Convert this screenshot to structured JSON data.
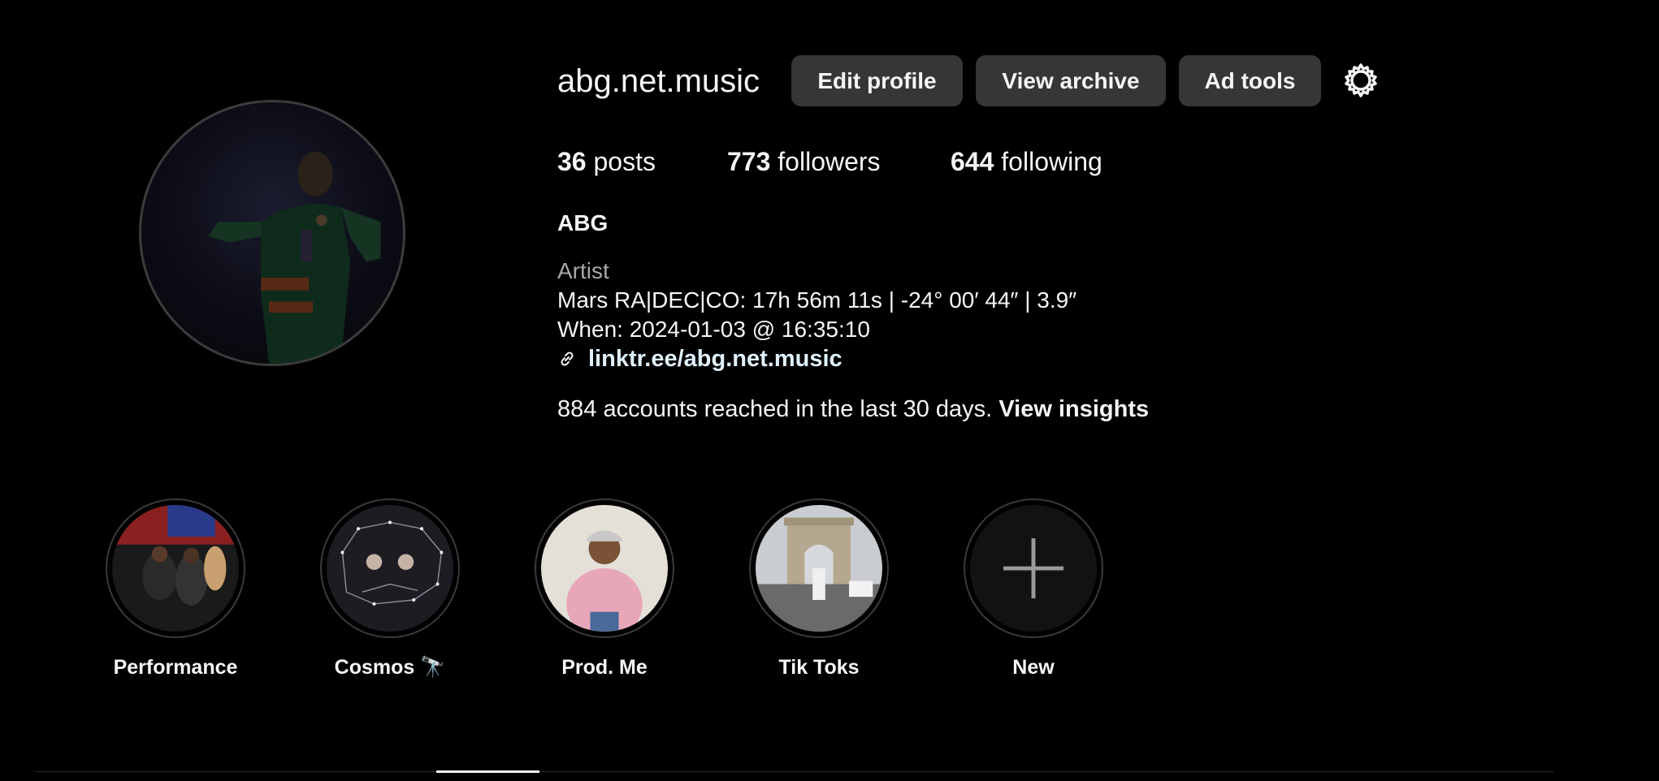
{
  "profile": {
    "username": "abg.net.music",
    "full_name": "ABG",
    "category": "Artist",
    "bio_lines": [
      "Mars RA|DEC|CO: 17h 56m 11s | -24° 00′ 44″ | 3.9″",
      "When: 2024-01-03 @ 16:35:10"
    ],
    "link": "linktr.ee/abg.net.music"
  },
  "actions": {
    "edit_profile": "Edit profile",
    "view_archive": "View archive",
    "ad_tools": "Ad tools"
  },
  "stats": {
    "posts_count": "36",
    "posts_label": "posts",
    "followers_count": "773",
    "followers_label": "followers",
    "following_count": "644",
    "following_label": "following"
  },
  "insights": {
    "text": "884 accounts reached in the last 30 days.",
    "link": "View insights"
  },
  "highlights": [
    {
      "label": "Performance"
    },
    {
      "label": "Cosmos 🔭"
    },
    {
      "label": "Prod. Me"
    },
    {
      "label": "Tik Toks"
    },
    {
      "label": "New"
    }
  ],
  "icons": {
    "settings": "gear-icon",
    "link": "link-icon",
    "new_highlight": "plus-icon"
  },
  "colors": {
    "background": "#000000",
    "button_bg": "#363636",
    "secondary_text": "#a8a8a8",
    "divider": "#262626"
  }
}
